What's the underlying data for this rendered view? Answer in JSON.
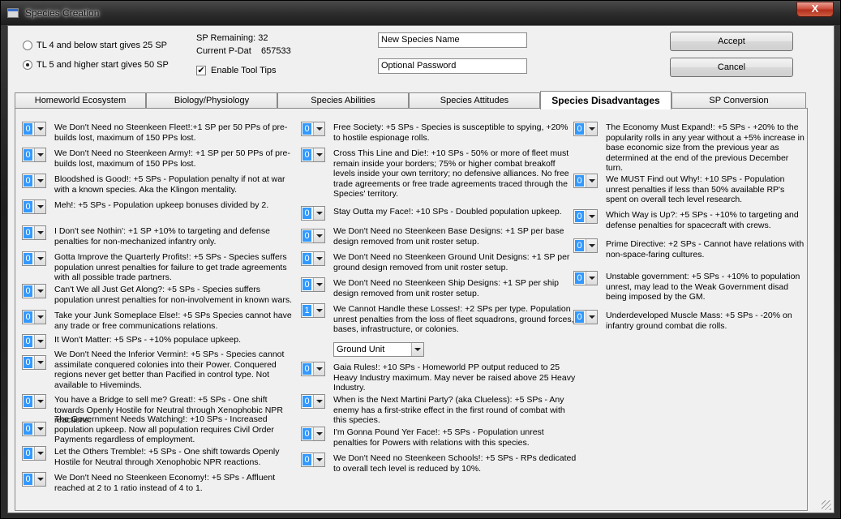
{
  "window": {
    "title": "Species Creation",
    "close_label": "X"
  },
  "options": {
    "radio_tl4": "TL 4 and below start gives 25 SP",
    "radio_tl5": "TL 5 and higher start gives 50 SP",
    "sp_remaining_label": "SP Remaining: 32",
    "pdat_label": "Current P-Dat",
    "pdat_value": "657533",
    "tooltips_label": "Enable Tool Tips",
    "tooltips_check": "✔",
    "species_name": "New Species Name",
    "password": "Optional Password",
    "accept_label": "Accept",
    "cancel_label": "Cancel"
  },
  "tabs": [
    "Homeworld Ecosystem",
    "Biology/Physiology",
    "Species Abilities",
    "Species Attitudes",
    "Species Disadvantages",
    "SP Conversion"
  ],
  "ground_unit_select": "Ground Unit",
  "col1": [
    {
      "v": "0",
      "t": "We Don't Need no Steenkeen Fleet!:+1 SP per 50 PPs of pre-builds lost, maximum of 150 PPs lost."
    },
    {
      "v": "0",
      "t": "We Don't Need no Steenkeen Army!: +1 SP per 50 PPs of pre-builds lost, maximum of 150 PPs lost."
    },
    {
      "v": "0",
      "t": "Bloodshed is Good!: +5 SPs - Population penalty if not at war with a known species. Aka the Klingon mentality."
    },
    {
      "v": "0",
      "t": "Meh!: +5 SPs - Population upkeep bonuses divided by 2."
    },
    {
      "v": "0",
      "t": "I Don't see Nothin': +1 SP +10% to targeting and defense penalties for non-mechanized infantry only."
    },
    {
      "v": "0",
      "t": "Gotta Improve the Quarterly Profits!: +5 SPs - Species suffers population unrest penalties for failure to get trade agreements with all possible trade partners."
    },
    {
      "v": "0",
      "t": "Can't We all Just Get Along?: +5 SPs - Species suffers population unrest penalties for non-involvement in known wars."
    },
    {
      "v": "0",
      "t": "Take your Junk Someplace Else!: +5 SPs Species cannot have any trade or free communications relations."
    },
    {
      "v": "0",
      "t": "It Won't Matter: +5 SPs - +10% populace upkeep."
    },
    {
      "v": "0",
      "t": "We Don't Need the Inferior Vermin!: +5 SPs - Species cannot assimilate conquered colonies into their Power. Conquered regions never get better than Pacified in control type. Not available to Hiveminds."
    },
    {
      "v": "0",
      "t": "You have a Bridge to sell me? Great!: +5 SPs - One shift towards Openly Hostile for Neutral through Xenophobic NPR reactions."
    },
    {
      "v": "0",
      "t": "The Government Needs Watching!: +10 SPs - Increased population upkeep. Now all population requires Civil Order Payments regardless of employment."
    },
    {
      "v": "0",
      "t": "Let the Others Tremble!: +5 SPs - One shift towards Openly Hostile for Neutral through Xenophobic NPR reactions."
    },
    {
      "v": "0",
      "t": "We Don't Need no Steenkeen Economy!: +5 SPs - Affluent reached at 2 to 1 ratio instead of 4 to 1."
    }
  ],
  "col2": [
    {
      "v": "0",
      "t": "Free Society: +5 SPs - Species is susceptible to spying, +20% to hostile espionage rolls."
    },
    {
      "v": "0",
      "t": "Cross This Line and Die!: +10 SPs - 50% or more of fleet must remain inside your borders; 75% or higher combat breakoff levels inside your own territory; no defensive alliances. No free trade agreements or free trade agreements traced through the Species' territory."
    },
    {
      "v": "0",
      "t": "Stay Outta my Face!: +10 SPs - Doubled population upkeep."
    },
    {
      "v": "0",
      "t": "We Don't Need no Steenkeen Base Designs: +1 SP per base design removed from unit roster setup."
    },
    {
      "v": "0",
      "t": "We Don't Need no Steenkeen Ground Unit Designs: +1 SP per ground design removed from unit roster setup."
    },
    {
      "v": "0",
      "t": "We Don't Need no Steenkeen Ship Designs: +1 SP per ship design removed from unit roster setup."
    },
    {
      "v": "1",
      "t": "We Cannot Handle these Losses!: +2 SPs per type. Population unrest penalties from the loss of fleet squadrons, ground forces, bases, infrastructure, or colonies."
    },
    {
      "v": "0",
      "t": "Gaia Rules!: +10 SPs - Homeworld PP output reduced to 25 Heavy Industry maximum. May never be raised above 25 Heavy Industry."
    },
    {
      "v": "0",
      "t": "When is the Next Martini Party? (aka Clueless): +5 SPs - Any enemy has a first-strike effect in the first round of combat with this species."
    },
    {
      "v": "0",
      "t": "I'm Gonna Pound Yer Face!: +5 SPs - Population unrest penalties for Powers with relations with this species."
    },
    {
      "v": "0",
      "t": "We Don't Need no Steenkeen Schools!: +5 SPs - RPs dedicated to overall tech level is reduced by 10%."
    }
  ],
  "col3": [
    {
      "v": "0",
      "t": "The Economy Must Expand!: +5 SPs - +20% to the popularity rolls in any year without a +5% increase in base economic size from the previous year as determined at the end of the previous December turn."
    },
    {
      "v": "0",
      "t": "We MUST Find out Why!: +10 SPs - Population unrest penalties if less than 50% available RP's spent on overall tech level research."
    },
    {
      "v": "0",
      "t": "Which Way is Up?: +5 SPs - +10% to targeting and defense penalties for spacecraft with crews."
    },
    {
      "v": "0",
      "t": "Prime Directive: +2 SPs - Cannot have relations with non-space-faring cultures."
    },
    {
      "v": "0",
      "t": "Unstable government: +5 SPs - +10% to population unrest, may lead to the Weak Government disad being imposed by the GM."
    },
    {
      "v": "0",
      "t": "Underdeveloped Muscle Mass: +5 SPs - -20% on infantry ground combat die rolls."
    }
  ]
}
